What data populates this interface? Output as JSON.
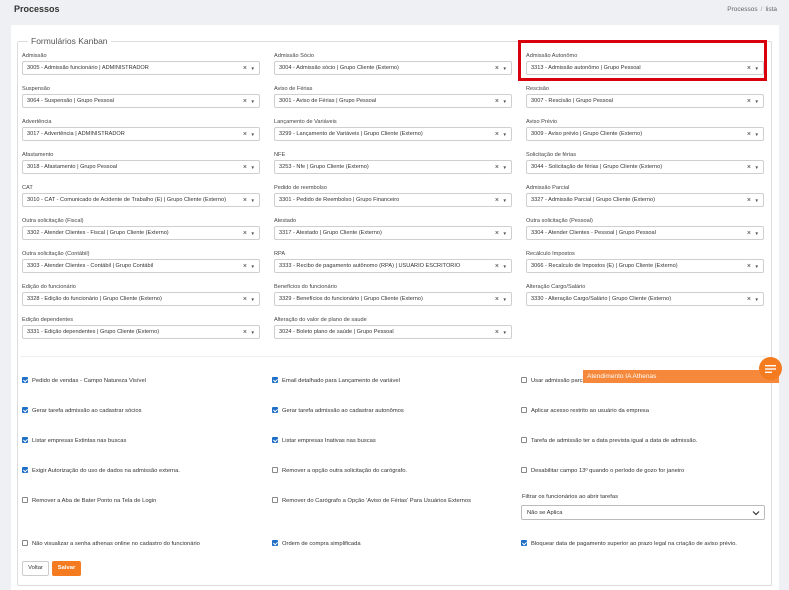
{
  "header": {
    "title": "Processos",
    "breadcrumb": [
      "Processos",
      "lista"
    ]
  },
  "section": {
    "legend": "Formulários Kanban"
  },
  "fields": [
    {
      "label": "Admissão",
      "value": "3005 - Admissão funcionário | ADMINISTRADOR"
    },
    {
      "label": "Admissão Sócio",
      "value": "3004 - Admissão sócio | Grupo Cliente (Externo)"
    },
    {
      "label": "Admissão Autonômo",
      "value": "3313 - Admissão autonômo | Grupo Pessoal"
    },
    {
      "label": "Suspensão",
      "value": "3064 - Suspensão | Grupo Pessoal"
    },
    {
      "label": "Aviso de Férias",
      "value": "3001 - Aviso de Férias | Grupo Pessoal"
    },
    {
      "label": "Rescisão",
      "value": "3007 - Rescisão | Grupo Pessoal"
    },
    {
      "label": "Advertência",
      "value": "3017 - Advertência | ADMINISTRADOR"
    },
    {
      "label": "Lançamento de Variáveis",
      "value": "3299 - Lançamento de Variáveis | Grupo Cliente (Externo)"
    },
    {
      "label": "Aviso Prévio",
      "value": "3009 - Aviso prévio | Grupo Cliente (Externo)"
    },
    {
      "label": "Afastamento",
      "value": "3018 - Afastamento | Grupo Pessoal"
    },
    {
      "label": "NFE",
      "value": "3253 - Nfe | Grupo Cliente (Externo)"
    },
    {
      "label": "Solicitação de férias",
      "value": "3044 - Solicitação de férias | Grupo Cliente (Externo)"
    },
    {
      "label": "CAT",
      "value": "3010 - CAT - Comunicado de Acidente de Trabalho (E) | Grupo Cliente (Externo)"
    },
    {
      "label": "Pedido de reembolso",
      "value": "3301 - Pedido de Reembolso | Grupo Financeiro"
    },
    {
      "label": "Admissão Parcial",
      "value": "3327 - Admissão Parcial | Grupo Cliente (Externo)"
    },
    {
      "label": "Outra solicitação (Fiscal)",
      "value": "3302 - Atender Clientes - Fiscal | Grupo Cliente (Externo)"
    },
    {
      "label": "Atestado",
      "value": "3317 - Atestado | Grupo Cliente (Externo)"
    },
    {
      "label": "Outra solicitação (Pessoal)",
      "value": "3304 - Atender Clientes - Pessoal | Grupo Pessoal"
    },
    {
      "label": "Outra solicitação (Contábil)",
      "value": "3303 - Atender Clientes - Contábil | Grupo Contábil"
    },
    {
      "label": "RPA",
      "value": "3333 - Recibo de pagamento autônomo (RPA) | USUARIO ESCRITORIO"
    },
    {
      "label": "Recálculo Impostos",
      "value": "3066 - Recalculo de Impostos (E) | Grupo Cliente (Externo)"
    },
    {
      "label": "Edição do funcionário",
      "value": "3328 - Edição do funcionário | Grupo Cliente (Externo)"
    },
    {
      "label": "Benefícios do funcionário",
      "value": "3329 - Benefícios do funcionário | Grupo Cliente (Externo)"
    },
    {
      "label": "Alteração Cargo/Salário",
      "value": "3330 - Alteração Cargo/Salário | Grupo Cliente (Externo)"
    },
    {
      "label": "Edição dependentes",
      "value": "3331 - Edição dependentes | Grupo Cliente (Externo)"
    },
    {
      "label": "Alteração do valor de plano de saude",
      "value": "3024 - Boleto plano de saúde | Grupo Pessoal"
    }
  ],
  "checkboxes": [
    {
      "label": "Pedido de vendas - Campo Natureza Visível",
      "checked": true
    },
    {
      "label": "Email detalhado para Lançamento de variável",
      "checked": true
    },
    {
      "label": "Usar admissão parcial",
      "checked": false
    },
    {
      "label": "Gerar tarefa admissão ao cadastrar sócios",
      "checked": true
    },
    {
      "label": "Gerar tarefa admissão ao cadastrar autonômos",
      "checked": true
    },
    {
      "label": "Aplicar acesso restrito ao usuário da empresa",
      "checked": false
    },
    {
      "label": "Listar empresas Extintas nas buscas",
      "checked": true
    },
    {
      "label": "Listar empresas Inativas nas buscas",
      "checked": true
    },
    {
      "label": "Tarefa de admissão ter a data prevista igual a data de admissão.",
      "checked": false
    },
    {
      "label": "Exigir Autorização do uso de dados na admissão externa.",
      "checked": true
    },
    {
      "label": "Remover a opção outra solicitação do carógrafo.",
      "checked": false
    },
    {
      "label": "Desabilitar campo 13º quando o período de gozo for janeiro",
      "checked": false
    },
    {
      "label": "Remover a Aba de Bater Ponto na Tela de Login",
      "checked": false
    },
    {
      "label": "Remover do Carógrafo a Opção 'Aviso de Férias' Para Usuários Externos",
      "checked": false
    },
    {
      "label": "Não visualizar a senha athenas online no cadastro do funcionário",
      "checked": false
    },
    {
      "label": "Ordem de compra simplificada",
      "checked": true
    },
    {
      "label": "Bloquear data de pagamento superior ao prazo legal na criação de aviso prévio.",
      "checked": true
    }
  ],
  "filter": {
    "label": "Filtrar os funcionários ao abrir tarefas",
    "value": "Não se Aplica"
  },
  "buttons": {
    "back": "Voltar",
    "save": "Salvar"
  },
  "chat": {
    "banner": "Atendimento IA Athenas"
  },
  "colors": {
    "accent": "#f47b20",
    "checkbox": "#1e6fc8",
    "highlight": "#d9000d"
  }
}
